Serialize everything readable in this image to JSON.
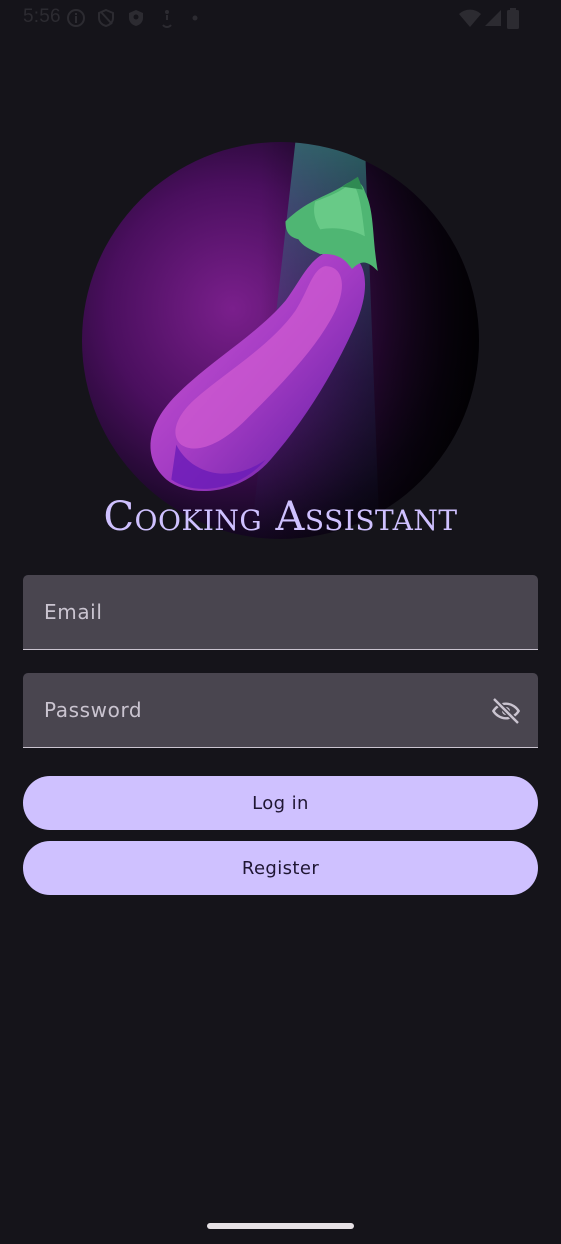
{
  "status_bar": {
    "time": "5:56",
    "icons": [
      "info-icon",
      "no-entry-icon",
      "shield-icon",
      "accessibility-icon",
      "dot-icon",
      "wifi-icon",
      "signal-icon",
      "battery-icon"
    ]
  },
  "logo": {
    "icon": "eggplant-logo"
  },
  "app_title": "Cooking Assistant",
  "form": {
    "email_placeholder": "Email",
    "password_placeholder": "Password",
    "visibility_icon": "eye-off-icon"
  },
  "buttons": {
    "login_label": "Log in",
    "register_label": "Register"
  },
  "colors": {
    "background": "#15141a",
    "accent": "#cfc1ff",
    "field_bg": "#49454f",
    "button_text": "#1f1633"
  }
}
